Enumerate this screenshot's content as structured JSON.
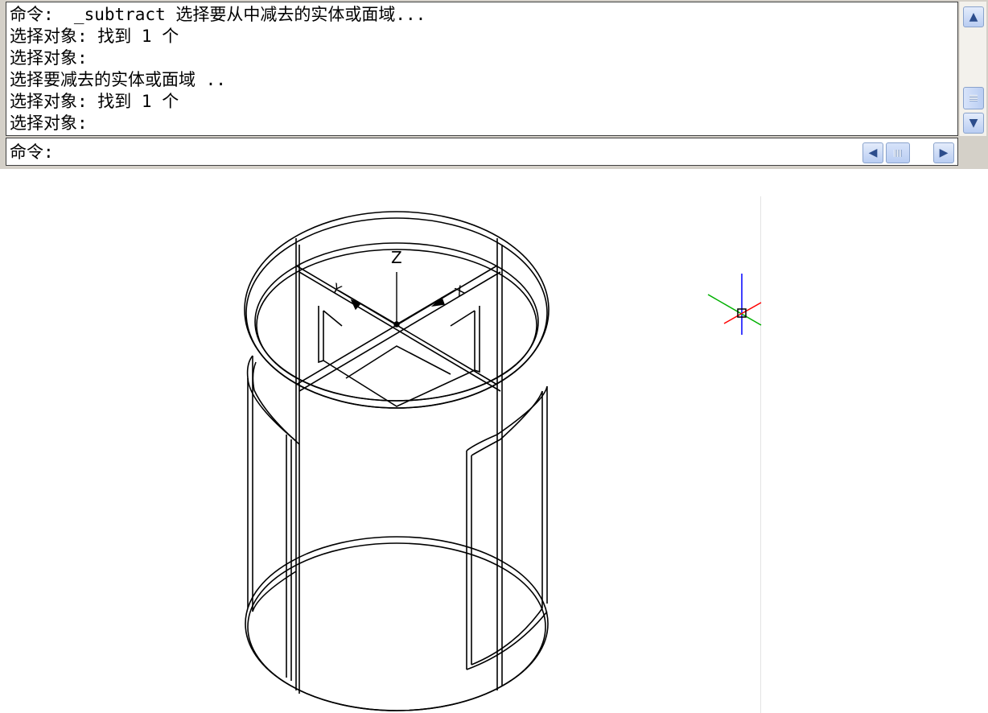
{
  "command_window": {
    "history": [
      "命令:  _subtract 选择要从中减去的实体或面域...",
      "选择对象: 找到 1 个",
      "选择对象:",
      "选择要减去的实体或面域 ..",
      "选择对象: 找到 1 个",
      "选择对象:"
    ],
    "prompt": "命令:"
  },
  "scrollbar_icons": {
    "up": "chevron-up-icon",
    "down": "chevron-down-icon",
    "left": "chevron-left-icon",
    "right": "chevron-right-icon"
  },
  "ucs_icon": {
    "z_label": "Z",
    "x_label": "X",
    "y_label": "Y"
  },
  "colors": {
    "window_bg": "#d4d0c8",
    "scroll_accent": "#b9cdf2",
    "crosshair_x": "#ff0000",
    "crosshair_y": "#00b000",
    "crosshair_z": "#0000ff"
  }
}
